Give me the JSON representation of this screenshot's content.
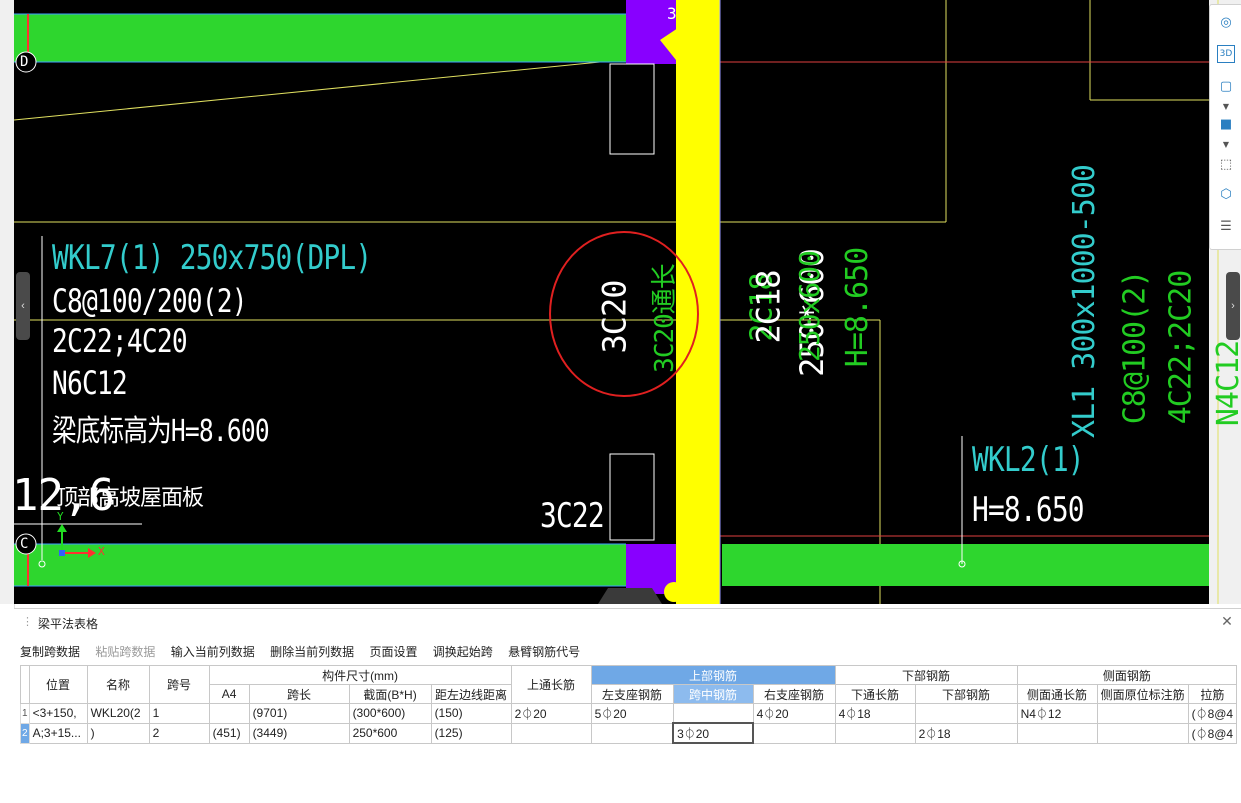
{
  "drawing": {
    "axis_label_3": "3",
    "axis_label_d": "D",
    "axis_label_c": "C",
    "coord_label": "12,6",
    "wkl7_lines": [
      "WKL7(1) 250x750(DPL)",
      "C8@100/200(2)",
      "2C22;4C20",
      "N6C12",
      "梁底标高为H=8.600"
    ],
    "wkl7_extra": "顶部高坡屋面板",
    "mark_3c20_white": "3C20",
    "mark_3c20_green": "3C20通长",
    "mark_3c22": "3C22",
    "mark_2c18_green": "2C18",
    "mark_2c18_white": "2C18",
    "mark_250x600_white": "250*600",
    "mark_250x600_green": "250x600",
    "mark_h8650_green": "H=8.650",
    "xl1_lines": [
      "XL1 300x1000-500",
      "C8@100(2)",
      "4C22;2C20",
      "N4C12"
    ],
    "wkl2_lines": [
      "WKL2(1)",
      "H=8.650"
    ],
    "axis_x": "X",
    "axis_y": "Y",
    "colors": {
      "cad_bg": "#000000",
      "beam_green": "#2ed62e",
      "column_purple": "#8800ff",
      "column_yellow": "#ffff00",
      "text_cyan": "#33cccc",
      "text_green": "#22cc22",
      "text_white": "#ffffff",
      "circle_red": "#e02020"
    }
  },
  "side_toolbar": {
    "icons": [
      "orbit-icon",
      "view-3d-icon",
      "cube-view-icon",
      "solid-cube-icon",
      "selection-box-icon",
      "cube-outline-icon",
      "properties-list-icon"
    ],
    "label_3d": "3D"
  },
  "panel": {
    "title": "梁平法表格",
    "toolbar": [
      {
        "label": "复制跨数据",
        "disabled": false
      },
      {
        "label": "粘贴跨数据",
        "disabled": true
      },
      {
        "label": "输入当前列数据",
        "disabled": false
      },
      {
        "label": "删除当前列数据",
        "disabled": false
      },
      {
        "label": "页面设置",
        "disabled": false
      },
      {
        "label": "调换起始跨",
        "disabled": false
      },
      {
        "label": "悬臂钢筋代号",
        "disabled": false
      }
    ],
    "group_headers": {
      "size": "构件尺寸(mm)",
      "top_rebar": "上部钢筋",
      "bottom_rebar": "下部钢筋",
      "side_rebar": "侧面钢筋"
    },
    "columns": {
      "position": "位置",
      "name": "名称",
      "span_no": "跨号",
      "a4": "A4",
      "span_length": "跨长",
      "section": "截面(B*H)",
      "edge_distance": "距左边线距离",
      "top_continuous": "上通长筋",
      "left_support": "左支座钢筋",
      "mid_span": "跨中钢筋",
      "right_support": "右支座钢筋",
      "bottom_continuous": "下通长筋",
      "bottom_rebar": "下部钢筋",
      "side_continuous": "侧面通长筋",
      "side_original": "侧面原位标注筋",
      "tie": "拉筋"
    },
    "rows": [
      {
        "num": "1",
        "position": "<3+150,",
        "name": "WKL20(2",
        "span_no": "1",
        "a4": "",
        "span_length": "(9701)",
        "section": "(300*600)",
        "edge_distance": "(150)",
        "top_continuous": "2⏀20",
        "left_support": "5⏀20",
        "mid_span": "",
        "right_support": "4⏀20",
        "bottom_continuous": "4⏀18",
        "bottom_rebar": "",
        "side_continuous": "N4⏀12",
        "side_original": "",
        "tie": "(⏀8@4"
      },
      {
        "num": "2",
        "position": "A;3+15...",
        "name": ")",
        "span_no": "2",
        "a4": "(451)",
        "span_length": "(3449)",
        "section": "250*600",
        "edge_distance": "(125)",
        "top_continuous": "",
        "left_support": "",
        "mid_span": "3⏀20",
        "right_support": "",
        "bottom_continuous": "",
        "bottom_rebar": "2⏀18",
        "side_continuous": "",
        "side_original": "",
        "tie": "(⏀8@4"
      }
    ]
  }
}
